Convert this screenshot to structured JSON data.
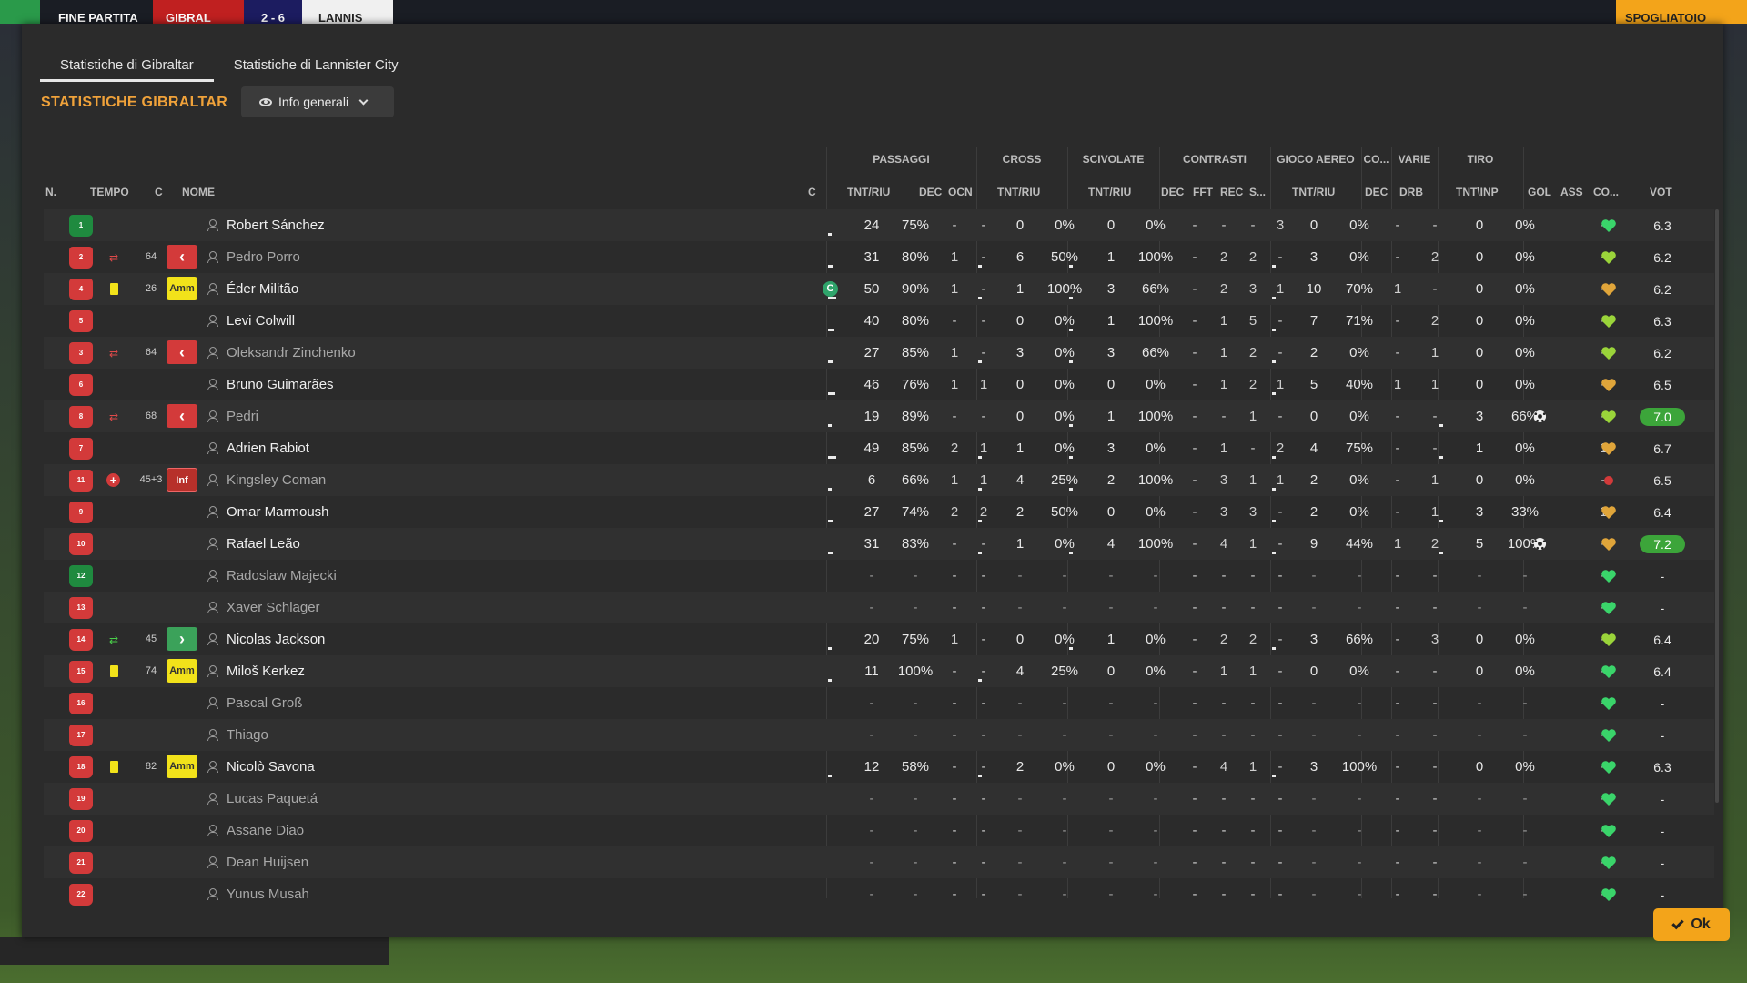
{
  "topbar": {
    "status": "FINE PARTITA",
    "home": "GIBRAL",
    "score": "2 - 6",
    "away": "LANNIS",
    "dressing": "SPOGLIATOIO"
  },
  "tabs": [
    {
      "label": "Statistiche di Gibraltar"
    },
    {
      "label": "Statistiche di Lannister City"
    }
  ],
  "section_title": "STATISTICHE GIBRALTAR",
  "view_select": "Info generali",
  "groups": {
    "passaggi": "PASSAGGI",
    "cross": "CROSS",
    "scivolate": "SCIVOLATE",
    "contrasti": "CONTRASTI",
    "gioco_aereo": "GIOCO AEREO",
    "co": "CO...",
    "varie": "VARIE",
    "tiro": "TIRO"
  },
  "headers": {
    "n": "N.",
    "tempo": "TEMPO",
    "c": "C",
    "nome": "NOME",
    "c2": "C",
    "pass_tr": "TNT/RIU",
    "pass_dec": "DEC",
    "pass_ocn": "OCN",
    "cross_tr": "TNT/RIU",
    "sciv_tr": "TNT/RIU",
    "con_dec": "DEC",
    "con_fft": "FFT",
    "con_rec": "REC",
    "con_s": "S...",
    "aer_tr": "TNT/RIU",
    "co_dec": "DEC",
    "var_drb": "DRB",
    "tiro": "TNT\\INP",
    "gol": "GOL",
    "ass": "ASS",
    "co2": "CO...",
    "vot": "VOT"
  },
  "players": [
    {
      "num": "1",
      "gk": true,
      "name": "Robert Sánchez",
      "pt": "24",
      "pp": "75%",
      "pdec": "-",
      "pocn": "-",
      "ct": "0",
      "cp": "0%",
      "st": "0",
      "sp": "0%",
      "dec": "-",
      "fft": "-",
      "rec": "-",
      "s": "3",
      "at": "0",
      "ap": "0%",
      "codec": "-",
      "drb": "-",
      "tt": "0",
      "tp": "0%",
      "gol": "",
      "ass": "-",
      "heart": "g",
      "vot": "6.3"
    },
    {
      "num": "2",
      "dim": true,
      "sub": "out",
      "tempo": "64",
      "badge": "out",
      "name": "Pedro Porro",
      "pt": "31",
      "pp": "80%",
      "pdec": "1",
      "pocn": "-",
      "ct": "6",
      "cp": "50%",
      "st": "1",
      "sp": "100%",
      "dec": "-",
      "fft": "2",
      "rec": "2",
      "s": "-",
      "at": "3",
      "ap": "0%",
      "codec": "-",
      "drb": "2",
      "tt": "0",
      "tp": "0%",
      "gol": "",
      "ass": "-",
      "heart": "y",
      "vot": "6.2"
    },
    {
      "num": "4",
      "card": "yellow",
      "tempo": "26",
      "badge": "amm",
      "badge_text": "Amm",
      "name": "Éder Militão",
      "captain": "C",
      "pt": "50",
      "pp": "90%",
      "pdec": "1",
      "pocn": "-",
      "ct": "1",
      "cp": "100%",
      "st": "3",
      "sp": "66%",
      "dec": "-",
      "fft": "2",
      "rec": "3",
      "s": "1",
      "at": "10",
      "ap": "70%",
      "codec": "1",
      "drb": "-",
      "tt": "0",
      "tp": "0%",
      "gol": "",
      "ass": "-",
      "heart": "o",
      "vot": "6.2"
    },
    {
      "num": "5",
      "name": "Levi Colwill",
      "pt": "40",
      "pp": "80%",
      "pdec": "-",
      "pocn": "-",
      "ct": "0",
      "cp": "0%",
      "st": "1",
      "sp": "100%",
      "dec": "-",
      "fft": "1",
      "rec": "5",
      "s": "-",
      "at": "7",
      "ap": "71%",
      "codec": "-",
      "drb": "2",
      "tt": "0",
      "tp": "0%",
      "gol": "",
      "ass": "-",
      "heart": "y",
      "vot": "6.3"
    },
    {
      "num": "3",
      "dim": true,
      "sub": "out",
      "tempo": "64",
      "badge": "out",
      "name": "Oleksandr Zinchenko",
      "pt": "27",
      "pp": "85%",
      "pdec": "1",
      "pocn": "-",
      "ct": "3",
      "cp": "0%",
      "st": "3",
      "sp": "66%",
      "dec": "-",
      "fft": "1",
      "rec": "2",
      "s": "-",
      "at": "2",
      "ap": "0%",
      "codec": "-",
      "drb": "1",
      "tt": "0",
      "tp": "0%",
      "gol": "",
      "ass": "-",
      "heart": "y",
      "vot": "6.2"
    },
    {
      "num": "6",
      "name": "Bruno Guimarães",
      "pt": "46",
      "pp": "76%",
      "pdec": "1",
      "pocn": "1",
      "ct": "0",
      "cp": "0%",
      "st": "0",
      "sp": "0%",
      "dec": "-",
      "fft": "1",
      "rec": "2",
      "s": "1",
      "at": "5",
      "ap": "40%",
      "codec": "1",
      "drb": "1",
      "tt": "0",
      "tp": "0%",
      "gol": "",
      "ass": "-",
      "heart": "o",
      "vot": "6.5"
    },
    {
      "num": "8",
      "dim": true,
      "sub": "out",
      "tempo": "68",
      "badge": "out",
      "name": "Pedri",
      "pt": "19",
      "pp": "89%",
      "pdec": "-",
      "pocn": "-",
      "ct": "0",
      "cp": "0%",
      "st": "1",
      "sp": "100%",
      "dec": "-",
      "fft": "-",
      "rec": "1",
      "s": "-",
      "at": "0",
      "ap": "0%",
      "codec": "-",
      "drb": "-",
      "tt": "3",
      "tp": "66%",
      "gol": "ball",
      "ass": "-",
      "heart": "y",
      "vot": "7.0",
      "vot_hi": true
    },
    {
      "num": "7",
      "name": "Adrien Rabiot",
      "pt": "49",
      "pp": "85%",
      "pdec": "2",
      "pocn": "1",
      "ct": "1",
      "cp": "0%",
      "st": "3",
      "sp": "0%",
      "dec": "-",
      "fft": "1",
      "rec": "-",
      "s": "2",
      "at": "4",
      "ap": "75%",
      "codec": "-",
      "drb": "-",
      "tt": "1",
      "tp": "0%",
      "gol": "",
      "ass": "1",
      "heart": "o",
      "vot": "6.7"
    },
    {
      "num": "11",
      "dim": true,
      "card": "injury",
      "tempo": "45+3",
      "badge": "inf",
      "badge_text": "Inf",
      "name": "Kingsley Coman",
      "pt": "6",
      "pp": "66%",
      "pdec": "1",
      "pocn": "1",
      "ct": "4",
      "cp": "25%",
      "st": "2",
      "sp": "100%",
      "dec": "-",
      "fft": "3",
      "rec": "1",
      "s": "1",
      "at": "2",
      "ap": "0%",
      "codec": "-",
      "drb": "1",
      "tt": "0",
      "tp": "0%",
      "gol": "",
      "ass": "-",
      "heart": "r",
      "vot": "6.5"
    },
    {
      "num": "9",
      "name": "Omar Marmoush",
      "pt": "27",
      "pp": "74%",
      "pdec": "2",
      "pocn": "2",
      "ct": "2",
      "cp": "50%",
      "st": "0",
      "sp": "0%",
      "dec": "-",
      "fft": "3",
      "rec": "3",
      "s": "-",
      "at": "2",
      "ap": "0%",
      "codec": "-",
      "drb": "1",
      "tt": "3",
      "tp": "33%",
      "gol": "",
      "ass": "1",
      "heart": "o",
      "vot": "6.4"
    },
    {
      "num": "10",
      "name": "Rafael Leão",
      "pt": "31",
      "pp": "83%",
      "pdec": "-",
      "pocn": "-",
      "ct": "1",
      "cp": "0%",
      "st": "4",
      "sp": "100%",
      "dec": "-",
      "fft": "4",
      "rec": "1",
      "s": "-",
      "at": "9",
      "ap": "44%",
      "codec": "1",
      "drb": "2",
      "tt": "5",
      "tp": "100%",
      "gol": "ball",
      "ass": "-",
      "heart": "o",
      "vot": "7.2",
      "vot_hi": true
    },
    {
      "num": "12",
      "gk": true,
      "dim": true,
      "name": "Radoslaw Majecki",
      "empty": true,
      "heart": "g",
      "vot": "-"
    },
    {
      "num": "13",
      "dim": true,
      "name": "Xaver Schlager",
      "empty": true,
      "heart": "g",
      "vot": "-"
    },
    {
      "num": "14",
      "sub": "in",
      "tempo": "45",
      "badge": "in",
      "name": "Nicolas Jackson",
      "pt": "20",
      "pp": "75%",
      "pdec": "1",
      "pocn": "-",
      "ct": "0",
      "cp": "0%",
      "st": "1",
      "sp": "0%",
      "dec": "-",
      "fft": "2",
      "rec": "2",
      "s": "-",
      "at": "3",
      "ap": "66%",
      "codec": "-",
      "drb": "3",
      "tt": "0",
      "tp": "0%",
      "gol": "",
      "ass": "-",
      "heart": "y",
      "vot": "6.4"
    },
    {
      "num": "15",
      "card": "yellow",
      "tempo": "74",
      "badge": "amm",
      "badge_text": "Amm",
      "name": "Miloš Kerkez",
      "pt": "11",
      "pp": "100%",
      "pdec": "-",
      "pocn": "-",
      "ct": "4",
      "cp": "25%",
      "st": "0",
      "sp": "0%",
      "dec": "-",
      "fft": "1",
      "rec": "1",
      "s": "-",
      "at": "0",
      "ap": "0%",
      "codec": "-",
      "drb": "-",
      "tt": "0",
      "tp": "0%",
      "gol": "",
      "ass": "-",
      "heart": "g",
      "vot": "6.4"
    },
    {
      "num": "16",
      "dim": true,
      "name": "Pascal Groß",
      "empty": true,
      "heart": "g",
      "vot": "-"
    },
    {
      "num": "17",
      "dim": true,
      "name": "Thiago",
      "empty": true,
      "heart": "g",
      "vot": "-"
    },
    {
      "num": "18",
      "card": "yellow",
      "tempo": "82",
      "badge": "amm",
      "badge_text": "Amm",
      "name": "Nicolò Savona",
      "pt": "12",
      "pp": "58%",
      "pdec": "-",
      "pocn": "-",
      "ct": "2",
      "cp": "0%",
      "st": "0",
      "sp": "0%",
      "dec": "-",
      "fft": "4",
      "rec": "1",
      "s": "-",
      "at": "3",
      "ap": "100%",
      "codec": "-",
      "drb": "-",
      "tt": "0",
      "tp": "0%",
      "gol": "",
      "ass": "-",
      "heart": "g",
      "vot": "6.3"
    },
    {
      "num": "19",
      "dim": true,
      "name": "Lucas Paquetá",
      "empty": true,
      "heart": "g",
      "vot": "-"
    },
    {
      "num": "20",
      "dim": true,
      "name": "Assane Diao",
      "empty": true,
      "heart": "g",
      "vot": "-"
    },
    {
      "num": "21",
      "dim": true,
      "name": "Dean Huijsen",
      "empty": true,
      "heart": "g",
      "vot": "-"
    },
    {
      "num": "22",
      "dim": true,
      "name": "Yunus Musah",
      "empty": true,
      "heart": "g",
      "vot": "-"
    }
  ],
  "ok_label": "Ok",
  "colors": {
    "accent": "#f0a23a",
    "ok": "#f3a41a",
    "shirt": "#d33a3a",
    "gk_shirt": "#1f8a3f",
    "high_rating": "#3ca53a"
  }
}
